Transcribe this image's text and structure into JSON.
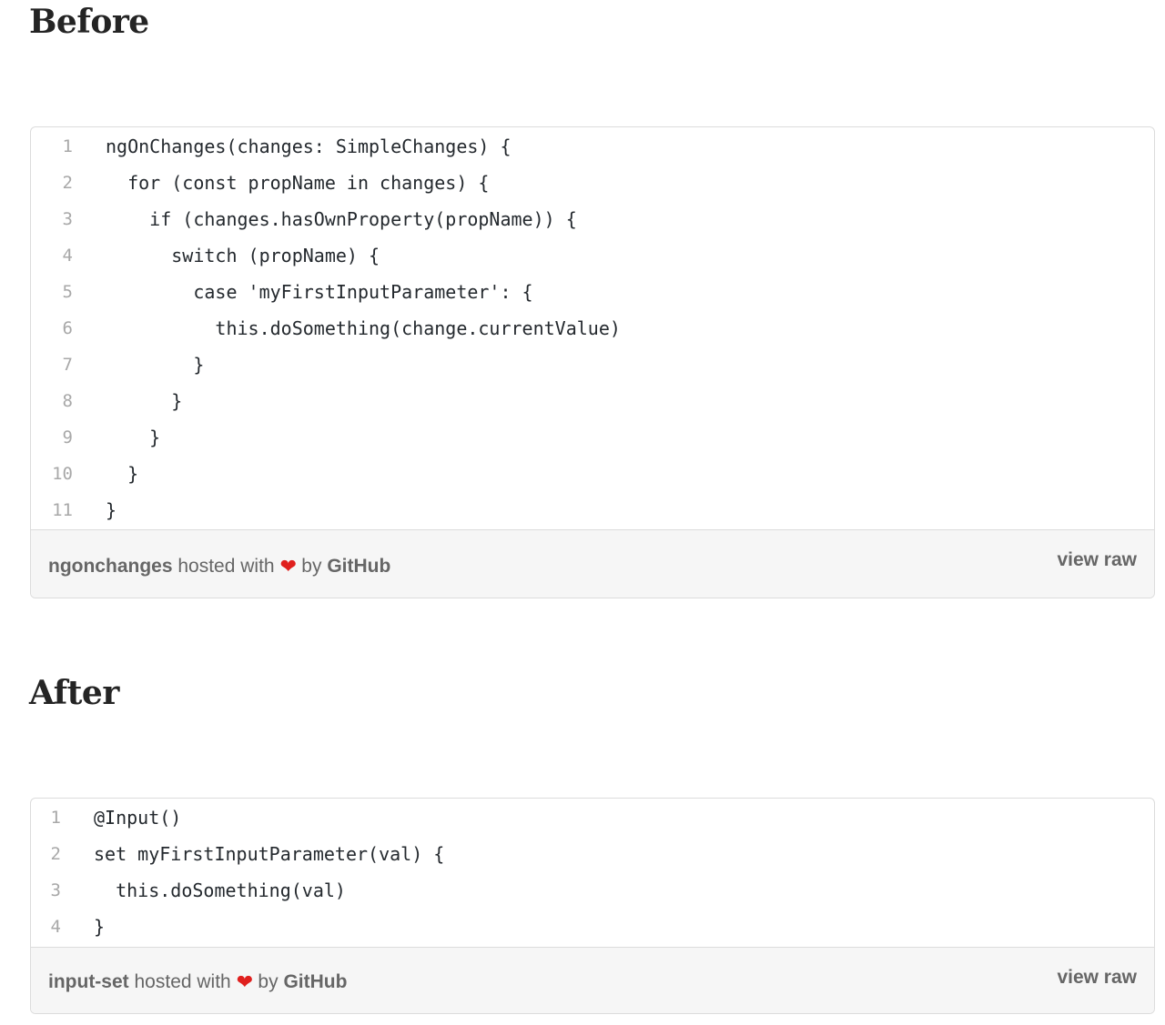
{
  "headings": {
    "before": "Before",
    "after": "After"
  },
  "gists": [
    {
      "lines": [
        {
          "num": "1",
          "code": "ngOnChanges(changes: SimpleChanges) {"
        },
        {
          "num": "2",
          "code": "  for (const propName in changes) {"
        },
        {
          "num": "3",
          "code": "    if (changes.hasOwnProperty(propName)) {"
        },
        {
          "num": "4",
          "code": "      switch (propName) {"
        },
        {
          "num": "5",
          "code": "        case 'myFirstInputParameter': {"
        },
        {
          "num": "6",
          "code": "          this.doSomething(change.currentValue)"
        },
        {
          "num": "7",
          "code": "        }"
        },
        {
          "num": "8",
          "code": "      }"
        },
        {
          "num": "9",
          "code": "    }"
        },
        {
          "num": "10",
          "code": "  }"
        },
        {
          "num": "11",
          "code": "}"
        }
      ],
      "footer": {
        "file_name": "ngonchanges",
        "hosted_with": "hosted with",
        "by": "by",
        "host": "GitHub",
        "view_raw": "view raw"
      }
    },
    {
      "lines": [
        {
          "num": "1",
          "code": "@Input()"
        },
        {
          "num": "2",
          "code": "set myFirstInputParameter(val) {"
        },
        {
          "num": "3",
          "code": "  this.doSomething(val)"
        },
        {
          "num": "4",
          "code": "}"
        }
      ],
      "footer": {
        "file_name": "input-set",
        "hosted_with": "hosted with",
        "by": "by",
        "host": "GitHub",
        "view_raw": "view raw"
      }
    }
  ],
  "icons": {
    "heart": "heart-icon"
  },
  "colors": {
    "heart": "#e0201e",
    "footer_bg": "#f6f6f6",
    "border": "#dcdcdc"
  }
}
